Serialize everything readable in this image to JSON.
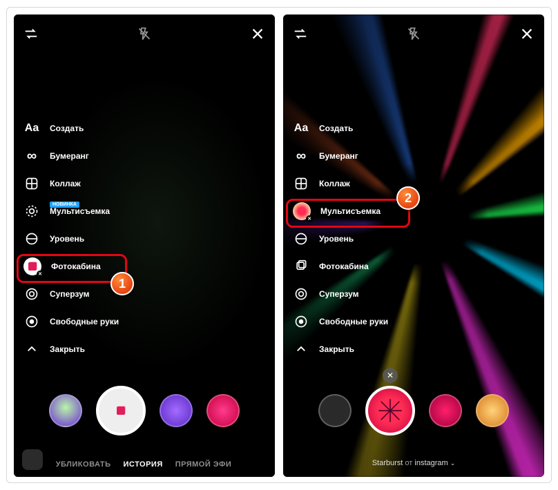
{
  "left": {
    "menu": {
      "create": "Создать",
      "boomerang": "Бумеранг",
      "layout": "Коллаж",
      "multi_badge": "НОВИНКА",
      "multi": "Мультисъемка",
      "level": "Уровень",
      "photobooth": "Фотокабина",
      "superzoom": "Суперзум",
      "handsfree": "Свободные руки",
      "close": "Закрыть"
    },
    "modes": {
      "publish_cut": "УБЛИКОВАТЬ",
      "story": "ИСТОРИЯ",
      "live_cut": "ПРЯМОЙ ЭФИ"
    },
    "callout": "1"
  },
  "right": {
    "menu": {
      "create": "Создать",
      "boomerang": "Бумеранг",
      "layout": "Коллаж",
      "multi": "Мультисъемка",
      "level": "Уровень",
      "photobooth": "Фотокабина",
      "superzoom": "Суперзум",
      "handsfree": "Свободные руки",
      "close": "Закрыть"
    },
    "filter_credit": {
      "name": "Starburst",
      "by": "от",
      "author": "instagram"
    },
    "callout": "2"
  }
}
